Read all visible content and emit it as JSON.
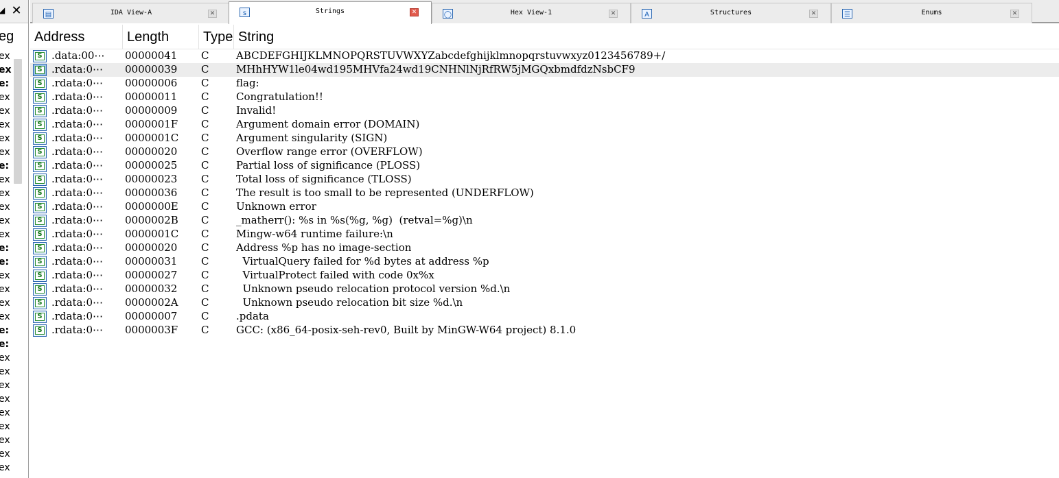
{
  "left_panel": {
    "header_fragment": "eg",
    "fragments": [
      {
        "text": "ex",
        "bold": false
      },
      {
        "text": "ex",
        "bold": true
      },
      {
        "text": "e:",
        "bold": true
      },
      {
        "text": "ex",
        "bold": false
      },
      {
        "text": "ex",
        "bold": false
      },
      {
        "text": "ex",
        "bold": false
      },
      {
        "text": "ex",
        "bold": false
      },
      {
        "text": "ex",
        "bold": false
      },
      {
        "text": "e:",
        "bold": true
      },
      {
        "text": "ex",
        "bold": false
      },
      {
        "text": "ex",
        "bold": false
      },
      {
        "text": "ex",
        "bold": false
      },
      {
        "text": "ex",
        "bold": false
      },
      {
        "text": "ex",
        "bold": false
      },
      {
        "text": "e:",
        "bold": true
      },
      {
        "text": "e:",
        "bold": true
      },
      {
        "text": "ex",
        "bold": false
      },
      {
        "text": "ex",
        "bold": false
      },
      {
        "text": "ex",
        "bold": false
      },
      {
        "text": "ex",
        "bold": false
      },
      {
        "text": "e:",
        "bold": true
      },
      {
        "text": "e:",
        "bold": true
      },
      {
        "text": "ex",
        "bold": false
      },
      {
        "text": "ex",
        "bold": false
      },
      {
        "text": "ex",
        "bold": false
      },
      {
        "text": "ex",
        "bold": false
      },
      {
        "text": "ex",
        "bold": false
      },
      {
        "text": "ex",
        "bold": false
      },
      {
        "text": "ex",
        "bold": false
      },
      {
        "text": "ex",
        "bold": false
      },
      {
        "text": "ex",
        "bold": false
      }
    ]
  },
  "tabs": [
    {
      "label": "IDA View-A",
      "icon": "ida-view-icon",
      "active": false
    },
    {
      "label": "Strings",
      "icon": "strings-icon",
      "active": true
    },
    {
      "label": "Hex View-1",
      "icon": "hex-view-icon",
      "active": false
    },
    {
      "label": "Structures",
      "icon": "structures-icon",
      "active": false
    },
    {
      "label": "Enums",
      "icon": "enums-icon",
      "active": false
    }
  ],
  "columns": [
    "Address",
    "Length",
    "Type",
    "String"
  ],
  "rows": [
    {
      "address": ".data:00⋯",
      "length": "00000041",
      "type": "C",
      "string": "ABCDEFGHIJKLMNOPQRSTUVWXYZabcdefghijklmnopqrstuvwxyz0123456789+/"
    },
    {
      "address": ".rdata:0⋯",
      "length": "00000039",
      "type": "C",
      "string": "MHhHYW1le04wd195MHVfa24wd19CNHNlNjRfRW5jMGQxbmdfdzNsbCF9",
      "selected": true
    },
    {
      "address": ".rdata:0⋯",
      "length": "00000006",
      "type": "C",
      "string": "flag:"
    },
    {
      "address": ".rdata:0⋯",
      "length": "00000011",
      "type": "C",
      "string": "Congratulation!!"
    },
    {
      "address": ".rdata:0⋯",
      "length": "00000009",
      "type": "C",
      "string": "Invalid!"
    },
    {
      "address": ".rdata:0⋯",
      "length": "0000001F",
      "type": "C",
      "string": "Argument domain error (DOMAIN)"
    },
    {
      "address": ".rdata:0⋯",
      "length": "0000001C",
      "type": "C",
      "string": "Argument singularity (SIGN)"
    },
    {
      "address": ".rdata:0⋯",
      "length": "00000020",
      "type": "C",
      "string": "Overflow range error (OVERFLOW)"
    },
    {
      "address": ".rdata:0⋯",
      "length": "00000025",
      "type": "C",
      "string": "Partial loss of significance (PLOSS)"
    },
    {
      "address": ".rdata:0⋯",
      "length": "00000023",
      "type": "C",
      "string": "Total loss of significance (TLOSS)"
    },
    {
      "address": ".rdata:0⋯",
      "length": "00000036",
      "type": "C",
      "string": "The result is too small to be represented (UNDERFLOW)"
    },
    {
      "address": ".rdata:0⋯",
      "length": "0000000E",
      "type": "C",
      "string": "Unknown error"
    },
    {
      "address": ".rdata:0⋯",
      "length": "0000002B",
      "type": "C",
      "string": "_matherr(): %s in %s(%g, %g)  (retval=%g)\\n"
    },
    {
      "address": ".rdata:0⋯",
      "length": "0000001C",
      "type": "C",
      "string": "Mingw-w64 runtime failure:\\n"
    },
    {
      "address": ".rdata:0⋯",
      "length": "00000020",
      "type": "C",
      "string": "Address %p has no image-section"
    },
    {
      "address": ".rdata:0⋯",
      "length": "00000031",
      "type": "C",
      "string": "  VirtualQuery failed for %d bytes at address %p"
    },
    {
      "address": ".rdata:0⋯",
      "length": "00000027",
      "type": "C",
      "string": "  VirtualProtect failed with code 0x%x"
    },
    {
      "address": ".rdata:0⋯",
      "length": "00000032",
      "type": "C",
      "string": "  Unknown pseudo relocation protocol version %d.\\n"
    },
    {
      "address": ".rdata:0⋯",
      "length": "0000002A",
      "type": "C",
      "string": "  Unknown pseudo relocation bit size %d.\\n"
    },
    {
      "address": ".rdata:0⋯",
      "length": "00000007",
      "type": "C",
      "string": ".pdata"
    },
    {
      "address": ".rdata:0⋯",
      "length": "0000003F",
      "type": "C",
      "string": "GCC: (x86_64-posix-seh-rev0, Built by MinGW-W64 project) 8.1.0"
    }
  ],
  "string_icon_glyph": "S",
  "colors": {
    "active_close": "#e15a4c",
    "selected_row": "#ececec",
    "icon_blue": "#2a66b0",
    "icon_green": "#1a7a1f"
  }
}
